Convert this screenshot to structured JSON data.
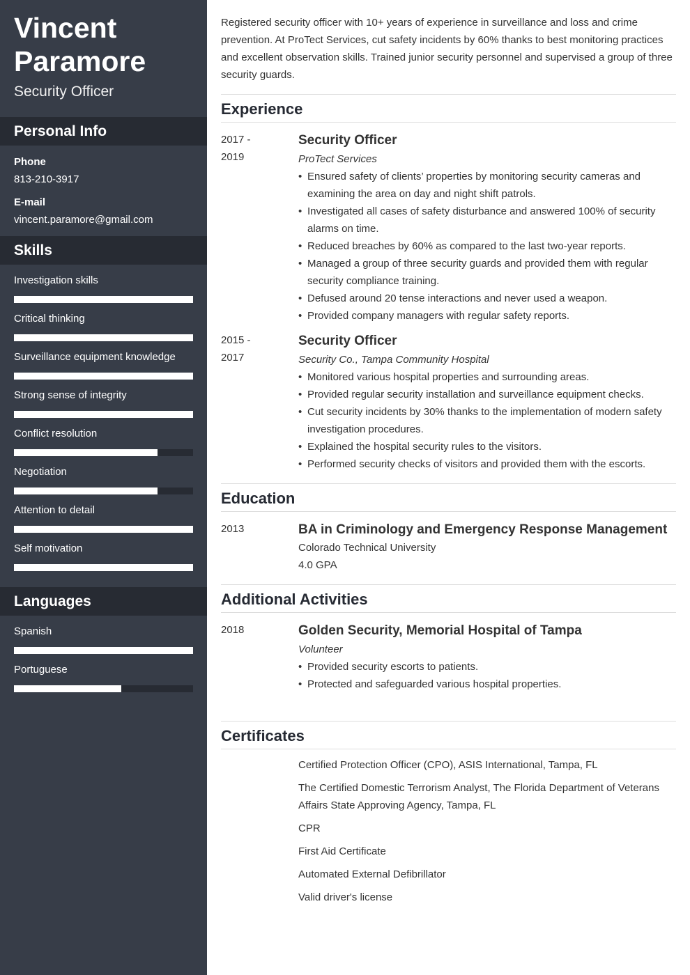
{
  "header": {
    "first_name": "Vincent",
    "last_name": "Paramore",
    "title": "Security Officer"
  },
  "personal_info": {
    "heading": "Personal Info",
    "phone_label": "Phone",
    "phone": "813-210-3917",
    "email_label": "E-mail",
    "email": "vincent.paramore@gmail.com"
  },
  "skills": {
    "heading": "Skills",
    "items": [
      {
        "name": "Investigation skills",
        "level": 1.0
      },
      {
        "name": "Critical thinking",
        "level": 1.0
      },
      {
        "name": "Surveillance equipment knowledge",
        "level": 1.0
      },
      {
        "name": "Strong sense of integrity",
        "level": 1.0
      },
      {
        "name": "Conflict resolution",
        "level": 0.8
      },
      {
        "name": "Negotiation",
        "level": 0.8
      },
      {
        "name": "Attention to detail",
        "level": 1.0
      },
      {
        "name": "Self motivation",
        "level": 1.0
      }
    ]
  },
  "languages": {
    "heading": "Languages",
    "items": [
      {
        "name": "Spanish",
        "level": 1.0
      },
      {
        "name": "Portuguese",
        "level": 0.6
      }
    ]
  },
  "summary": "Registered security officer with 10+ years of experience in surveillance and loss and crime prevention. At ProTect Services, cut safety incidents by 60% thanks to best monitoring practices and excellent observation skills. Trained junior security personnel and supervised a group of three security guards.",
  "experience": {
    "heading": "Experience",
    "items": [
      {
        "date_start": "2017 -",
        "date_end": "2019",
        "title": "Security Officer",
        "company": "ProTect Services",
        "bullets": [
          "Ensured safety of clients’ properties by monitoring security cameras and examining the area on day and night shift patrols.",
          "Investigated all cases of safety disturbance and answered 100% of security alarms on time.",
          "Reduced breaches by 60% as compared to the last two-year reports.",
          "Managed a group of three security guards and provided them with regular security compliance training.",
          "Defused around 20 tense interactions and never used a weapon.",
          "Provided company managers with regular safety reports."
        ]
      },
      {
        "date_start": "2015 -",
        "date_end": "2017",
        "title": "Security Officer",
        "company": "Security Co., Tampa Community Hospital",
        "bullets": [
          "Monitored various hospital properties and surrounding areas.",
          "Provided regular security installation and surveillance equipment checks.",
          "Cut security incidents by 30% thanks to the implementation of modern safety investigation procedures.",
          "Explained the hospital security rules to the visitors.",
          "Performed security checks of visitors and provided them with the escorts."
        ]
      }
    ]
  },
  "education": {
    "heading": "Education",
    "date": "2013",
    "degree": "BA in Criminology and Emergency Response Management",
    "school": "Colorado Technical University",
    "gpa": "4.0 GPA"
  },
  "activities": {
    "heading": "Additional Activities",
    "date": "2018",
    "title": "Golden Security, Memorial Hospital of Tampa",
    "role": "Volunteer",
    "bullets": [
      "Provided security escorts to patients.",
      "Protected and safeguarded various hospital properties."
    ]
  },
  "certificates": {
    "heading": "Certificates",
    "items": [
      "Certified Protection Officer (CPO), ASIS International, Tampa, FL",
      "The Certified Domestic Terrorism Analyst, The Florida Department of Veterans Affairs State Approving Agency, Tampa, FL",
      "CPR",
      "First Aid Certificate",
      "Automated External Defibrillator",
      "Valid driver's license"
    ]
  }
}
